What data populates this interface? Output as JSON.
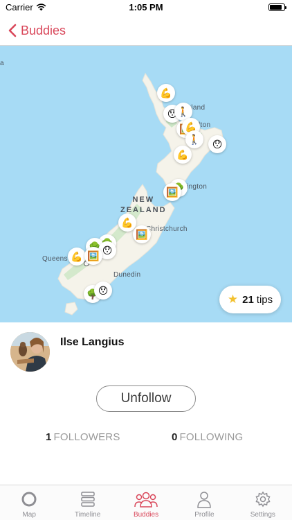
{
  "status_bar": {
    "carrier": "Carrier",
    "time": "1:05 PM"
  },
  "nav": {
    "back_label": "Buddies",
    "accent_color": "#d9475a"
  },
  "map": {
    "edge_label": "a",
    "country_label_line1": "NEW",
    "country_label_line2": "ZEALAND",
    "place_labels": {
      "auckland": "kland",
      "hamilton": "lton",
      "wellington": "llington",
      "christchurch": "Christchurch",
      "queenstown": "Queens",
      "dunedin": "Dunedin"
    },
    "pins": [
      {
        "icon": "flexed-biceps",
        "emoji": "💪"
      },
      {
        "icon": "hushed-face",
        "emoji": "😯"
      },
      {
        "icon": "person-walking",
        "emoji": "🚶"
      },
      {
        "icon": "picture-frame",
        "emoji": "🖼️"
      },
      {
        "icon": "flexed-biceps",
        "emoji": "💪"
      },
      {
        "icon": "person-walking",
        "emoji": "🚶"
      },
      {
        "icon": "hushed-face",
        "emoji": "😯"
      },
      {
        "icon": "flexed-biceps",
        "emoji": "💪"
      },
      {
        "icon": "deciduous-tree",
        "emoji": "🌳"
      },
      {
        "icon": "picture-frame",
        "emoji": "🖼️"
      },
      {
        "icon": "flexed-biceps",
        "emoji": "💪"
      },
      {
        "icon": "picture-frame",
        "emoji": "🖼️"
      },
      {
        "icon": "deciduous-tree",
        "emoji": "🌳"
      },
      {
        "icon": "deciduous-tree",
        "emoji": "🌳"
      },
      {
        "icon": "hushed-face",
        "emoji": "😯"
      },
      {
        "icon": "flexed-biceps",
        "emoji": "💪"
      },
      {
        "icon": "picture-frame",
        "emoji": "🖼️"
      },
      {
        "icon": "deciduous-tree",
        "emoji": "🌳"
      },
      {
        "icon": "hushed-face",
        "emoji": "😯"
      }
    ],
    "tips_count": "21",
    "tips_label": "tips"
  },
  "profile": {
    "name": "Ilse Langius",
    "unfollow_label": "Unfollow"
  },
  "stats": {
    "followers_count": "1",
    "followers_label": "FOLLOWERS",
    "following_count": "0",
    "following_label": "FOLLOWING"
  },
  "tabs": [
    {
      "label": "Map",
      "icon": "map-circle-icon"
    },
    {
      "label": "Timeline",
      "icon": "timeline-stack-icon"
    },
    {
      "label": "Buddies",
      "icon": "buddies-icon",
      "active": true
    },
    {
      "label": "Profile",
      "icon": "person-icon"
    },
    {
      "label": "Settings",
      "icon": "gear-icon"
    }
  ]
}
